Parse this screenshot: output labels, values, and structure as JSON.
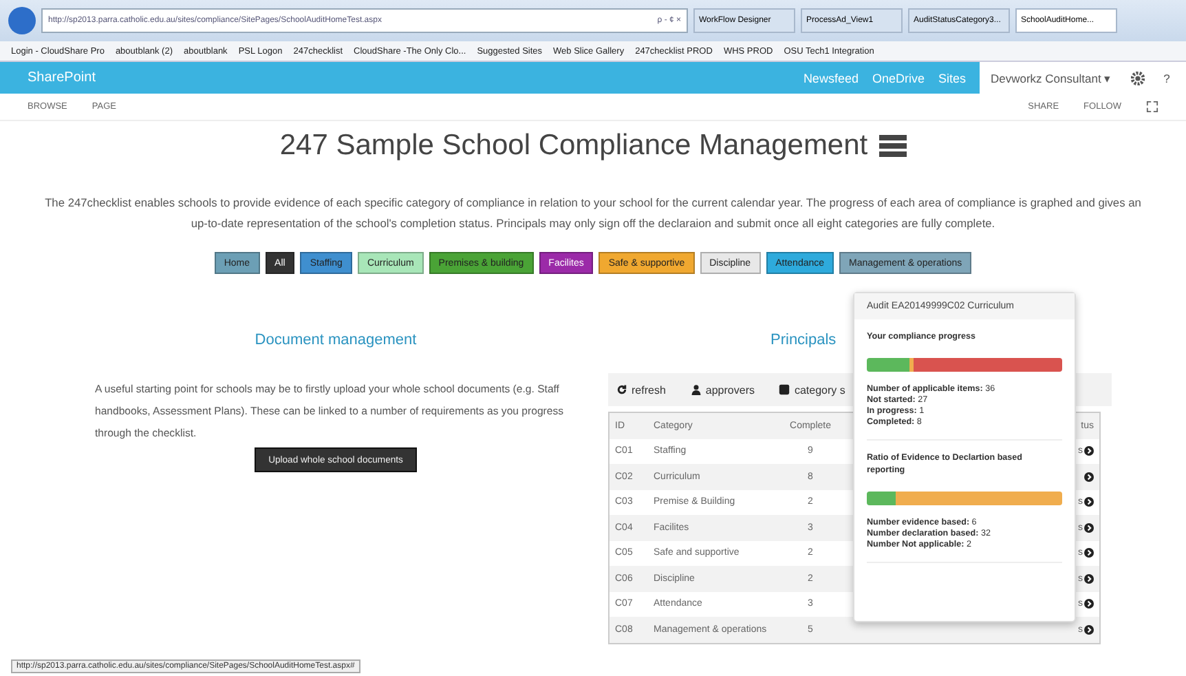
{
  "browser": {
    "address": "http://sp2013.parra.catholic.edu.au/sites/compliance/SitePages/SchoolAuditHomeTest.aspx",
    "search_hint": "ρ - ¢ ×",
    "tabs": [
      {
        "label": "WorkFlow Designer",
        "selected": false
      },
      {
        "label": "ProcessAd_View1",
        "selected": false
      },
      {
        "label": "AuditStatusCategory3...",
        "selected": false
      },
      {
        "label": "SchoolAuditHome...",
        "selected": true
      }
    ],
    "favorites": [
      "Login - CloudShare Pro",
      "aboutblank (2)",
      "aboutblank",
      "PSL Logon",
      "247checklist",
      "CloudShare -The Only Clo...",
      "Suggested Sites",
      "Web Slice Gallery",
      "247checklist PROD",
      "WHS PROD",
      "OSU Tech1 Integration"
    ]
  },
  "suitebar": {
    "brand": "SharePoint",
    "links": [
      "Newsfeed",
      "OneDrive",
      "Sites"
    ],
    "user": "Devworkz Consultant ▾",
    "help": "?"
  },
  "ribbon": {
    "tabs": [
      "BROWSE",
      "PAGE"
    ],
    "actions": [
      "SHARE",
      "FOLLOW"
    ]
  },
  "page": {
    "title": "247 Sample School Compliance Management",
    "description": "The 247checklist enables schools to provide evidence of each specific category of compliance in relation to your school for the current calendar year. The progress of each area of compliance is graphed and gives an up-to-date representation of the school's completion status.  Principals may only sign off the declaraion and submit once all eight categories are fully complete.",
    "nav": [
      {
        "label": "Home",
        "color": "#6c9fb5"
      },
      {
        "label": "All",
        "color": "#333333"
      },
      {
        "label": "Staffing",
        "color": "#3f8fcf"
      },
      {
        "label": "Curriculum",
        "color": "#a8e6b8"
      },
      {
        "label": "Premises & building",
        "color": "#4aa336"
      },
      {
        "label": "Facilites",
        "color": "#9b2aa8"
      },
      {
        "label": "Safe & supportive",
        "color": "#f0a830"
      },
      {
        "label": "Discipline",
        "color": "#e8e8e8"
      },
      {
        "label": "Attendance",
        "color": "#2eaadc"
      },
      {
        "label": "Management & operations",
        "color": "#7fa5b8"
      }
    ]
  },
  "documents": {
    "heading": "Document management",
    "text": "A useful starting point for schools may be to firstly upload your whole school documents (e.g. Staff handbooks, Assessment Plans). These can be linked to a number of requirements as you progress through the checklist.",
    "button": "Upload whole school documents"
  },
  "principals": {
    "heading": "Principals",
    "toolbar": [
      "refresh",
      "approvers",
      "category s"
    ],
    "columns": [
      "ID",
      "Category",
      "Complete",
      "tus"
    ],
    "rows": [
      {
        "id": "C01",
        "category": "Staffing",
        "complete": "9",
        "status": "s"
      },
      {
        "id": "C02",
        "category": "Curriculum",
        "complete": "8",
        "status": ""
      },
      {
        "id": "C03",
        "category": "Premise & Building",
        "complete": "2",
        "status": "s"
      },
      {
        "id": "C04",
        "category": "Facilites",
        "complete": "3",
        "status": "s"
      },
      {
        "id": "C05",
        "category": "Safe and supportive",
        "complete": "2",
        "status": "s"
      },
      {
        "id": "C06",
        "category": "Discipline",
        "complete": "2",
        "status": "s"
      },
      {
        "id": "C07",
        "category": "Attendance",
        "complete": "3",
        "status": "s"
      },
      {
        "id": "C08",
        "category": "Management & operations",
        "complete": "5",
        "status": "s"
      }
    ]
  },
  "popover": {
    "title": "Audit EA20149999C02 Curriculum",
    "sections": [
      {
        "heading": "Your compliance progress",
        "segments": [
          {
            "level": 0.22,
            "color": "#5cb85c"
          },
          {
            "level": 0.02,
            "color": "#f0ad4e"
          },
          {
            "level": 0.76,
            "color": "#d9534f"
          }
        ],
        "stats": [
          {
            "label": "Number of applicable items:",
            "value": "36"
          },
          {
            "label": "Not started:",
            "value": "27"
          },
          {
            "label": "In progress:",
            "value": "1"
          },
          {
            "label": "Completed:",
            "value": "8"
          }
        ]
      },
      {
        "heading": "Ratio of Evidence to Declartion based reporting",
        "segments": [
          {
            "level": 0.15,
            "color": "#5cb85c"
          },
          {
            "level": 0.85,
            "color": "#f0ad4e"
          }
        ],
        "stats": [
          {
            "label": "Number evidence based:",
            "value": "6"
          },
          {
            "label": "Number declaration based:",
            "value": "32"
          },
          {
            "label": "Number Not applicable:",
            "value": "2"
          }
        ]
      }
    ]
  },
  "status_url": "http://sp2013.parra.catholic.edu.au/sites/compliance/SitePages/SchoolAuditHomeTest.aspx#"
}
